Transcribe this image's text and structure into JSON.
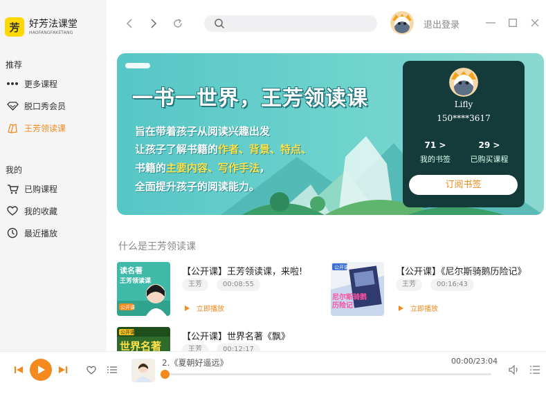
{
  "brand": {
    "logo_char": "芳",
    "name": "好芳法课堂",
    "pinyin": "HAOFANGFAKETANG"
  },
  "sidebar": {
    "recommend_title": "推荐",
    "recommend_items": [
      {
        "label": "更多课程",
        "icon": "more-dots-icon"
      },
      {
        "label": "脱口秀会员",
        "icon": "diamond-icon"
      },
      {
        "label": "王芳领读课",
        "icon": "book-icon",
        "active": true
      }
    ],
    "mine_title": "我的",
    "mine_items": [
      {
        "label": "已购课程",
        "icon": "cart-icon"
      },
      {
        "label": "我的收藏",
        "icon": "heart-icon"
      },
      {
        "label": "最近播放",
        "icon": "clock-icon"
      }
    ]
  },
  "topbar": {
    "search_placeholder": "",
    "logout_label": "退出登录"
  },
  "banner": {
    "title": "一书一世界，王芳领读课",
    "line1": "旨在带着孩子从阅读兴趣出发",
    "line2_pre": "让孩子了解书籍的",
    "line2_hl": "作者、背景、特点、",
    "line3_pre": "书籍的",
    "line3_hl": "主要内容、写作手法",
    "line3_post": "，",
    "line4": "全面提升孩子的阅读能力。"
  },
  "profile": {
    "name": "Lifly",
    "phone": "150****3617",
    "stat_books_num": "71 >",
    "stat_books_label": "我的书签",
    "stat_courses_num": "29 >",
    "stat_courses_label": "已购买课程",
    "subscribe_label": "订阅书签"
  },
  "section": {
    "heading": "什么是王芳领读课"
  },
  "courses": [
    {
      "title": "【公开课】王芳领读课，来啦!",
      "author": "王芳",
      "duration": "00:08:55",
      "play": "立即播放",
      "thumb_text": "读名著",
      "thumb_sub": "王芳领读课",
      "thumb_badge": "公开课"
    },
    {
      "title": "【公开课】《尼尔斯骑鹅历险记》",
      "author": "王芳",
      "duration": "00:16:43",
      "play": "立即播放",
      "thumb_text": "尼尔斯骑鹅历险记",
      "thumb_badge": "公开课"
    },
    {
      "title": "【公开课】世界名著《飘》",
      "author": "王芳",
      "duration": "00:12:17",
      "thumb_text": "世界名著",
      "thumb_badge": "公开课"
    }
  ],
  "player": {
    "track_title": "2.《夏朝好遥远》",
    "time": "00:00/23:04",
    "progress": 0.0
  },
  "colors": {
    "accent": "#f4891e",
    "banner_teal": "#56c6c6",
    "card_dark": "#153a3a"
  }
}
